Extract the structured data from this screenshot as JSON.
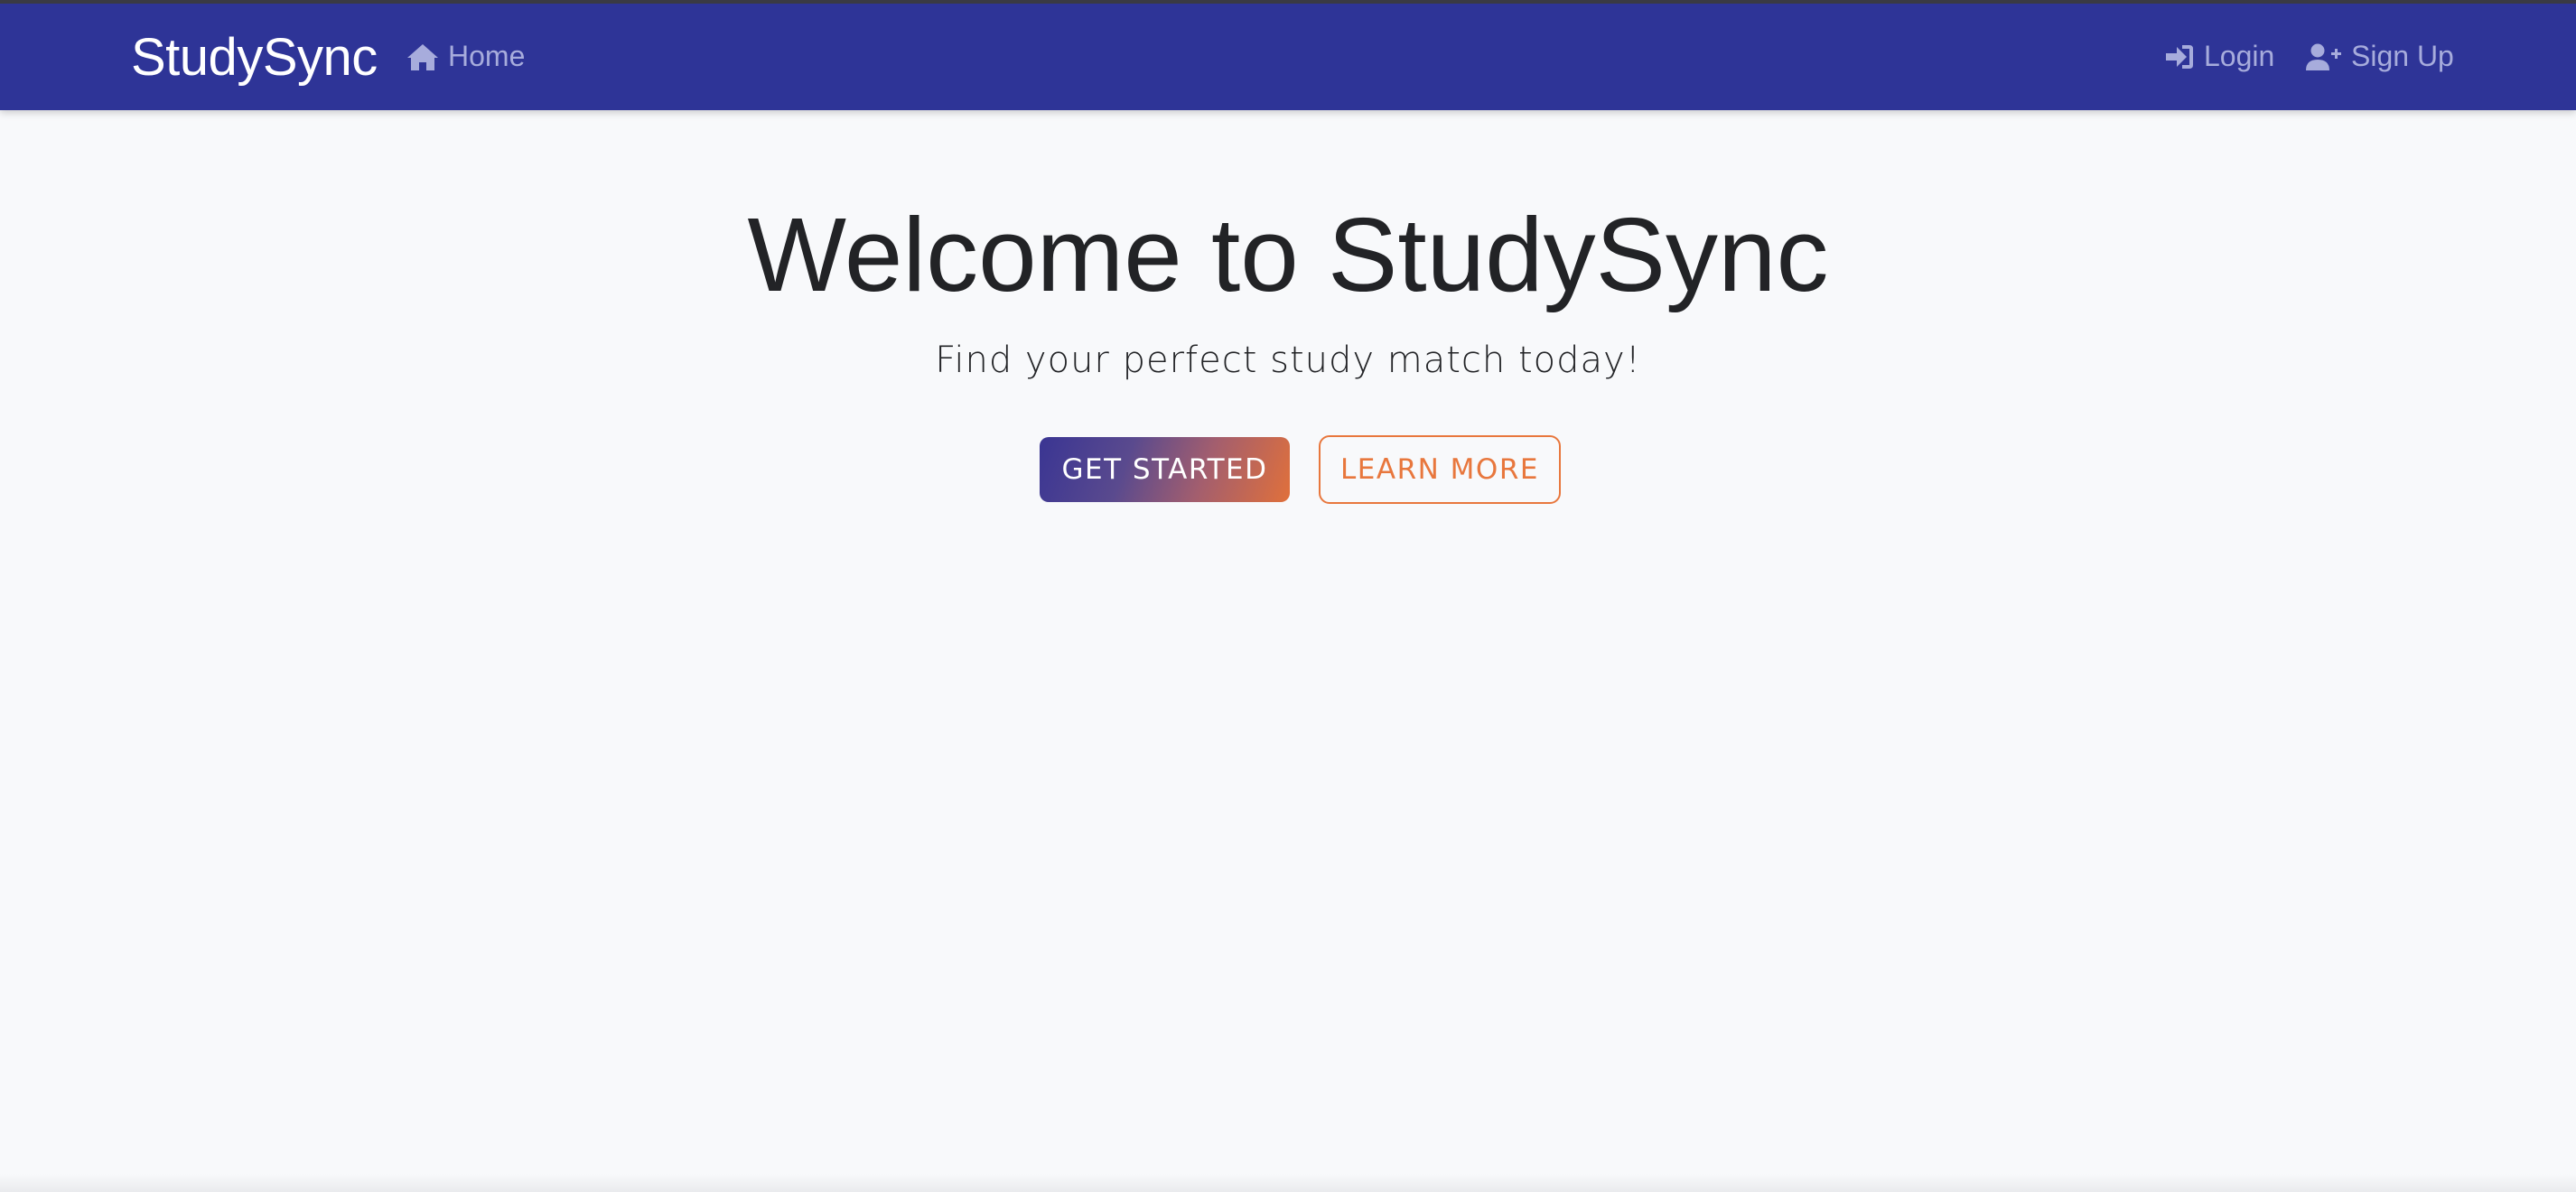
{
  "header": {
    "brand": "StudySync",
    "nav_left": [
      {
        "label": "Home",
        "icon": "home-icon"
      }
    ],
    "nav_right": [
      {
        "label": "Login",
        "icon": "login-icon"
      },
      {
        "label": "Sign Up",
        "icon": "user-plus-icon"
      }
    ]
  },
  "hero": {
    "title": "Welcome to StudySync",
    "subtitle": "Find your perfect study match today!",
    "primary_button": "GET STARTED",
    "secondary_button": "LEARN MORE"
  },
  "colors": {
    "header_bg": "#2e3497",
    "nav_text": "#a7acdc",
    "accent_orange": "#e8773d",
    "page_bg": "#f8f9fb",
    "text_dark": "#222326"
  }
}
